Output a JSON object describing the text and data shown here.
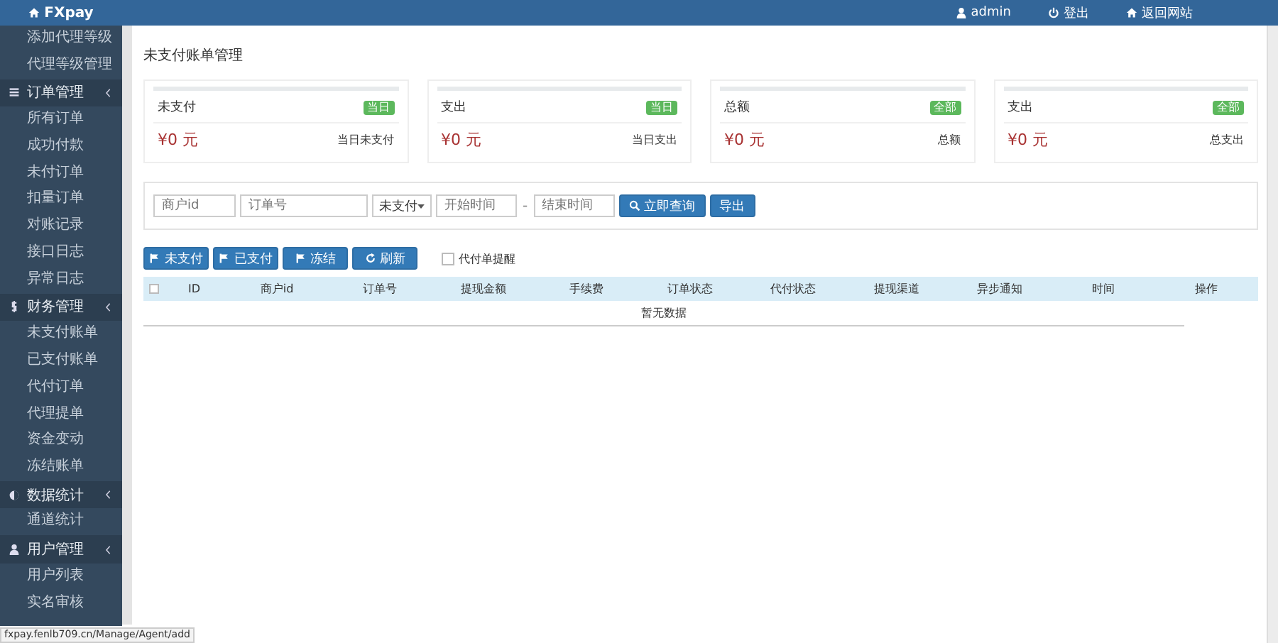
{
  "topbar": {
    "brand": "FXpay",
    "nav": [
      {
        "label": "admin"
      },
      {
        "label": "登出"
      },
      {
        "label": "返回网站"
      }
    ]
  },
  "sidebar": {
    "items": [
      {
        "label": "添加代理等级"
      },
      {
        "label": "代理等级管理"
      },
      {
        "label": "订单管理",
        "children": [
          {
            "label": "所有订单"
          },
          {
            "label": "成功付款"
          },
          {
            "label": "未付订单"
          },
          {
            "label": "扣量订单"
          },
          {
            "label": "对账记录"
          },
          {
            "label": "接口日志"
          },
          {
            "label": "异常日志"
          }
        ]
      },
      {
        "label": "财务管理",
        "children": [
          {
            "label": "未支付账单"
          },
          {
            "label": "已支付账单"
          },
          {
            "label": "代付订单"
          },
          {
            "label": "代理提单"
          },
          {
            "label": "资金变动"
          },
          {
            "label": "冻结账单"
          }
        ]
      },
      {
        "label": "数据统计",
        "children": [
          {
            "label": "通道统计"
          }
        ]
      },
      {
        "label": "用户管理",
        "children": [
          {
            "label": "用户列表"
          },
          {
            "label": "实名审核"
          }
        ]
      }
    ]
  },
  "page_title": "未支付账单管理",
  "cards": [
    {
      "title": "未支付",
      "badge": "当日",
      "amount": "¥0 元",
      "note": "当日未支付"
    },
    {
      "title": "支出",
      "badge": "当日",
      "amount": "¥0 元",
      "note": "当日支出"
    },
    {
      "title": "总额",
      "badge": "全部",
      "amount": "¥0 元",
      "note": "总额"
    },
    {
      "title": "支出",
      "badge": "全部",
      "amount": "¥0 元",
      "note": "总支出"
    }
  ],
  "filter": {
    "merchant_id": {
      "placeholder": "商户id"
    },
    "order_no": {
      "placeholder": "订单号"
    },
    "status_select": {
      "value": "未支付"
    },
    "start_time": {
      "placeholder": "开始时间"
    },
    "separator": "-",
    "end_time": {
      "placeholder": "结束时间"
    },
    "search_button": "立即查询",
    "export_button": "导出"
  },
  "toolbar": {
    "buttons": [
      {
        "label": "未支付"
      },
      {
        "label": "已支付"
      },
      {
        "label": "冻结"
      },
      {
        "label": "刷新"
      }
    ],
    "reminder": {
      "label": "代付单提醒",
      "checked": false
    }
  },
  "table": {
    "select_all": {
      "checked": false
    },
    "columns": [
      "ID",
      "商户id",
      "订单号",
      "提现金额",
      "手续费",
      "订单状态",
      "代付状态",
      "提现渠道",
      "异步通知",
      "时间",
      "操作"
    ],
    "empty_text": "暂无数据"
  },
  "status_bar": "fxpay.fenlb709.cn/Manage/Agent/add"
}
